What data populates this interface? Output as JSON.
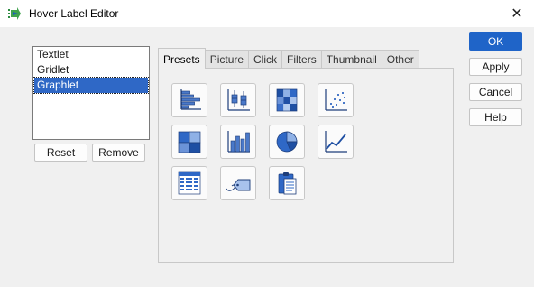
{
  "window": {
    "title": "Hover Label Editor",
    "app_icon": "jmp-arrow-icon",
    "close_icon": "close-icon",
    "close_glyph": "✕"
  },
  "list": {
    "items": [
      "Textlet",
      "Gridlet",
      "Graphlet"
    ],
    "selected": "Graphlet"
  },
  "list_buttons": {
    "reset": "Reset",
    "remove": "Remove"
  },
  "side_buttons": {
    "ok": "OK",
    "apply": "Apply",
    "cancel": "Cancel",
    "help": "Help"
  },
  "tabs": [
    "Presets",
    "Picture",
    "Click",
    "Filters",
    "Thumbnail",
    "Other"
  ],
  "active_tab": "Presets",
  "presets": [
    "horizontal-bar-chart-icon",
    "box-plot-icon",
    "heatmap-icon",
    "scatter-plot-icon",
    "treemap-icon",
    "bar-chart-icon",
    "pie-chart-icon",
    "line-chart-icon",
    "data-table-icon",
    "label-tag-icon",
    "clipboard-icon"
  ],
  "colors": {
    "accent": "#1f64c8",
    "selection": "#2f68c6",
    "icon_blue": "#4a79c9",
    "icon_dark": "#1d3d7a"
  }
}
